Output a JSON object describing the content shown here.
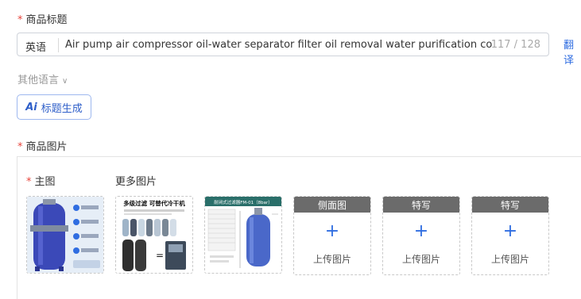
{
  "title_section": {
    "required_mark": "*",
    "label": "商品标题",
    "language": "英语",
    "value": "Air pump air compressor oil-water separator filter oil removal water purification compre",
    "char_count": "117 / 128",
    "translate_label": "翻译"
  },
  "other_languages": {
    "label": "其他语言"
  },
  "generate_button": {
    "ai_badge": "Ai",
    "label": "标题生成"
  },
  "images_section": {
    "required_mark": "*",
    "label": "商品图片",
    "main_label": "主图",
    "more_label": "更多图片",
    "thumbnail_2_text": "多级过滤 可替代冷干机",
    "thumbnail_3_text": "耐闭式过滤器FM-01（8bar）",
    "slots": [
      {
        "header": "侧面图",
        "plus": "+",
        "upload": "上传图片"
      },
      {
        "header": "特写",
        "plus": "+",
        "upload": "上传图片"
      },
      {
        "header": "特写",
        "plus": "+",
        "upload": "上传图片"
      }
    ]
  }
}
